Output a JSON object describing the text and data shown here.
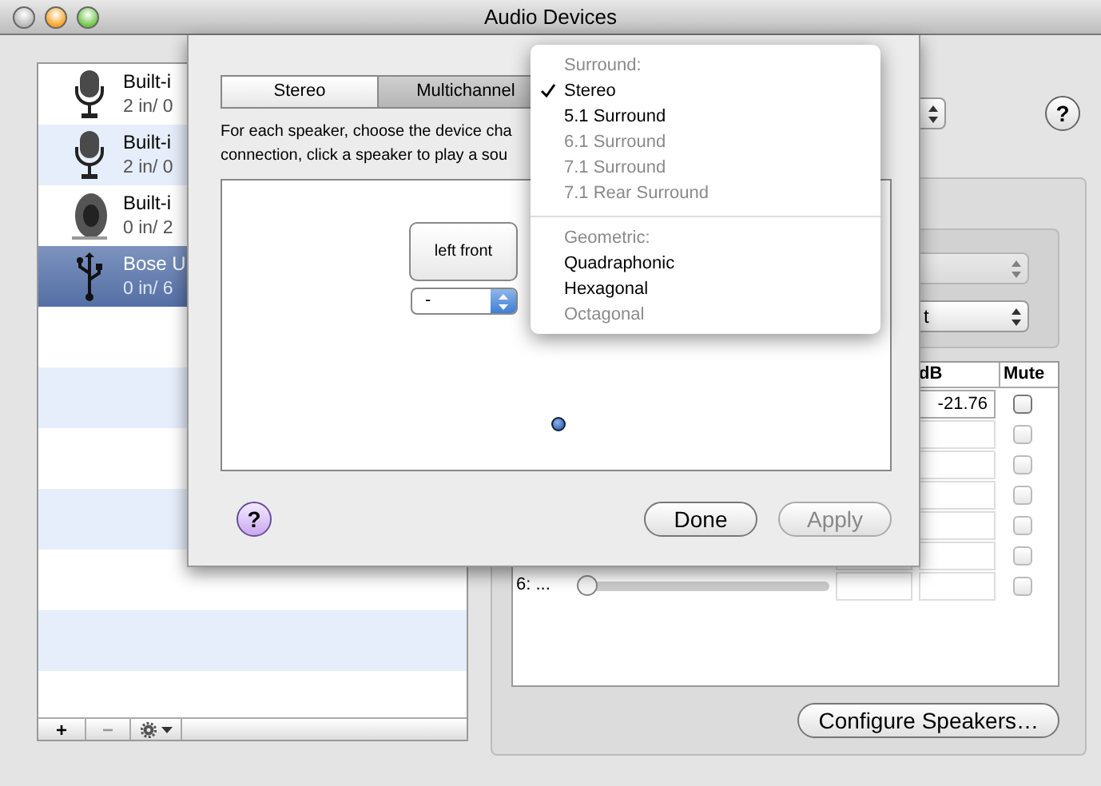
{
  "window": {
    "title": "Audio Devices"
  },
  "devices": [
    {
      "kind": "microphone",
      "name": "Built-i",
      "io": "2 in/ 0",
      "selected": false
    },
    {
      "kind": "microphone",
      "name": "Built-i",
      "io": "2 in/ 0",
      "selected": false
    },
    {
      "kind": "speaker",
      "name": "Built-i",
      "io": "0 in/ 2",
      "selected": false
    },
    {
      "kind": "usb",
      "name": "Bose U",
      "io": "0 in/ 6",
      "selected": true
    }
  ],
  "list_buttons": [
    {
      "label": "+",
      "disabled": false
    },
    {
      "label": "−",
      "disabled": true
    }
  ],
  "right_panel": {
    "help_button": "?",
    "group": {
      "channel_popup": {
        "disabled": true
      },
      "format_popup": {
        "value": "t",
        "disabled": false
      }
    },
    "table": {
      "columns": [
        "dB",
        "Mute"
      ],
      "rows": [
        {
          "db": "-21.76",
          "muted": false,
          "disabled": false
        },
        {
          "muted": false,
          "disabled": true
        },
        {
          "muted": false,
          "disabled": true
        },
        {
          "muted": false,
          "disabled": true
        },
        {
          "muted": false,
          "disabled": true
        },
        {
          "muted": false,
          "disabled": true
        },
        {
          "label": "6: ...",
          "level": 0,
          "muted": false,
          "disabled": true
        }
      ]
    },
    "configure_button": "Configure Speakers…"
  },
  "sheet": {
    "tabs": [
      {
        "label": "Stereo",
        "selected": false
      },
      {
        "label": "Multichannel",
        "selected": true
      }
    ],
    "instructions": [
      "For each speaker, choose the device cha",
      "connection, click a speaker to play a sou"
    ],
    "speakers": [
      {
        "label": "left front",
        "channel": "-"
      }
    ],
    "help_button": "?",
    "buttons": [
      {
        "label": "Done",
        "disabled": false
      },
      {
        "label": "Apply",
        "disabled": true
      }
    ]
  },
  "menu": {
    "items": [
      {
        "kind": "header",
        "label": "Surround:"
      },
      {
        "kind": "item",
        "label": "Stereo",
        "selected": true,
        "disabled": false
      },
      {
        "kind": "item",
        "label": "5.1 Surround",
        "selected": false,
        "disabled": false
      },
      {
        "kind": "item",
        "label": "6.1 Surround",
        "selected": false,
        "disabled": true
      },
      {
        "kind": "item",
        "label": "7.1 Surround",
        "selected": false,
        "disabled": true
      },
      {
        "kind": "item",
        "label": "7.1 Rear Surround",
        "selected": false,
        "disabled": true
      },
      {
        "kind": "separator"
      },
      {
        "kind": "header",
        "label": "Geometric:"
      },
      {
        "kind": "item",
        "label": "Quadraphonic",
        "selected": false,
        "disabled": false
      },
      {
        "kind": "item",
        "label": "Hexagonal",
        "selected": false,
        "disabled": false
      },
      {
        "kind": "item",
        "label": "Octagonal",
        "selected": false,
        "disabled": true
      }
    ]
  }
}
